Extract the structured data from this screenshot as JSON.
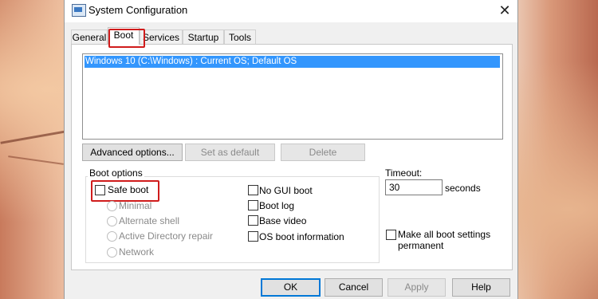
{
  "window": {
    "title": "System Configuration"
  },
  "tabs": [
    "General",
    "Boot",
    "Services",
    "Startup",
    "Tools"
  ],
  "boot_entries": [
    "Windows 10 (C:\\Windows) : Current OS; Default OS"
  ],
  "list_buttons": {
    "advanced": "Advanced options...",
    "set_default": "Set as default",
    "delete": "Delete"
  },
  "boot_options": {
    "label": "Boot options",
    "safe_boot": "Safe boot",
    "safe_boot_checked": false,
    "safe_modes": [
      "Minimal",
      "Alternate shell",
      "Active Directory repair",
      "Network"
    ],
    "extra": [
      "No GUI boot",
      "Boot log",
      "Base video",
      "OS boot information"
    ]
  },
  "timeout": {
    "label": "Timeout:",
    "value": "30",
    "unit": "seconds"
  },
  "make_permanent": {
    "line1": "Make all boot settings",
    "line2": "permanent"
  },
  "footer": {
    "ok": "OK",
    "cancel": "Cancel",
    "apply": "Apply",
    "help": "Help"
  },
  "colors": {
    "selection": "#3396fd",
    "highlight_outline": "#d01c1c",
    "default_button_border": "#0078d7"
  }
}
